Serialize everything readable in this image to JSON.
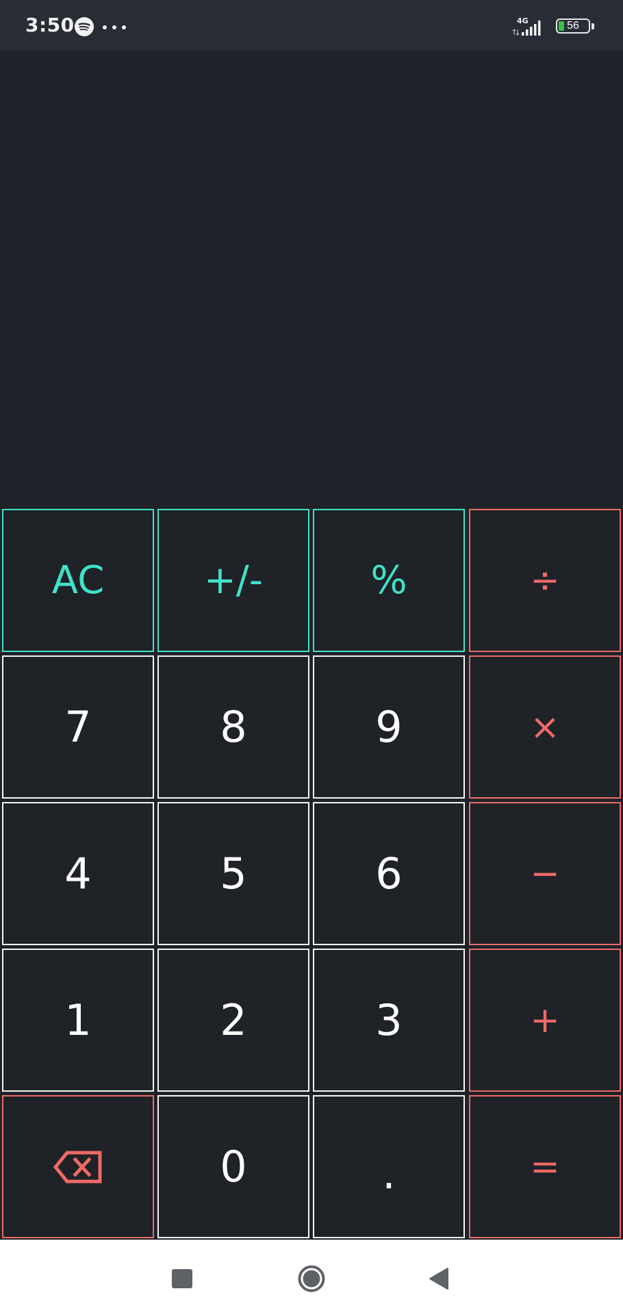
{
  "status_bar": {
    "time": "3:50",
    "battery_level": "56",
    "network": "4G",
    "icons": [
      "spotify-icon",
      "more-dots-icon",
      "signal-icon",
      "battery-icon"
    ]
  },
  "display": {
    "value": ""
  },
  "keypad": {
    "rows": [
      [
        "AC",
        "+/-",
        "%",
        "÷"
      ],
      [
        "7",
        "8",
        "9",
        "×"
      ],
      [
        "4",
        "5",
        "6",
        "−"
      ],
      [
        "1",
        "2",
        "3",
        "+"
      ],
      [
        "backspace",
        "0",
        ".",
        "="
      ]
    ],
    "keys": {
      "ac": "AC",
      "sign": "+/-",
      "percent": "%",
      "divide": "÷",
      "seven": "7",
      "eight": "8",
      "nine": "9",
      "multiply": "×",
      "four": "4",
      "five": "5",
      "six": "6",
      "minus": "−",
      "one": "1",
      "two": "2",
      "three": "3",
      "plus": "+",
      "zero": "0",
      "decimal": ".",
      "equals": "="
    },
    "colors": {
      "function": "#3fe3c8",
      "operator": "#ee6b66",
      "digit": "#ffffff",
      "background": "#1f2226"
    }
  },
  "nav_bar": {
    "icons": [
      "recents-square-icon",
      "home-circle-icon",
      "back-triangle-icon"
    ]
  }
}
